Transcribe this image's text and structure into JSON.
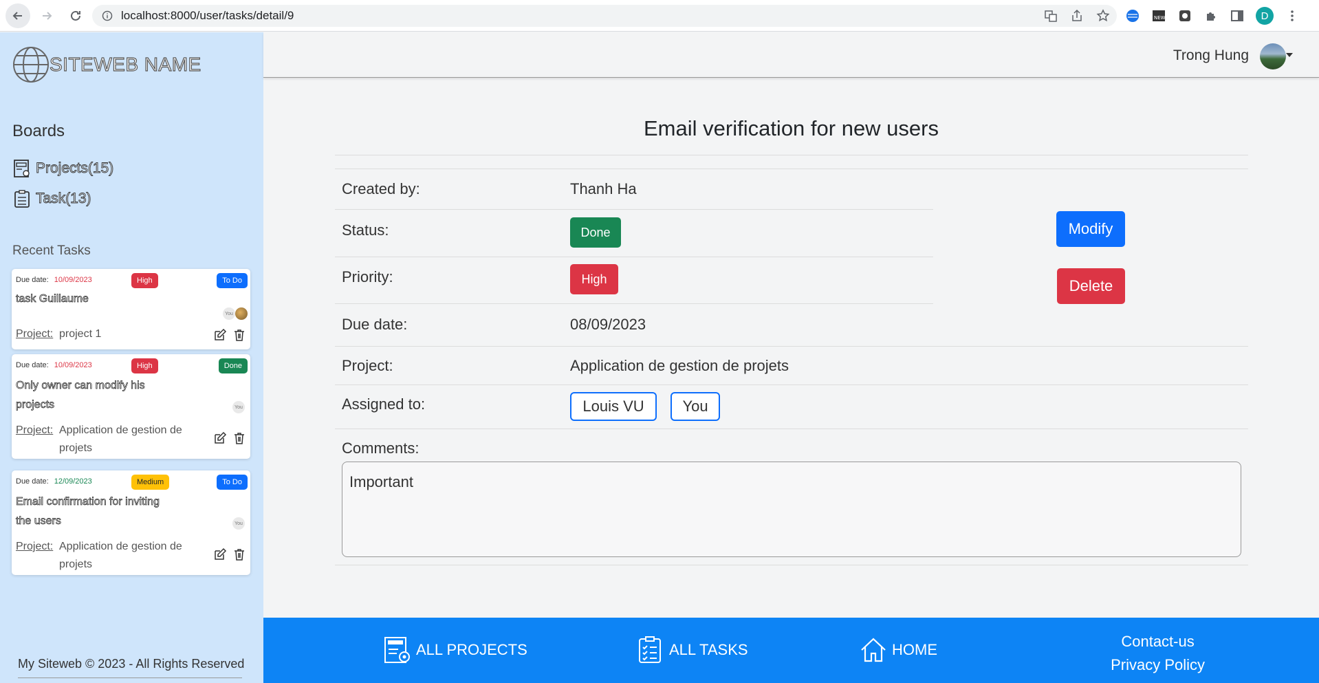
{
  "browser": {
    "url": "localhost:8000/user/tasks/detail/9",
    "profile_initial": "D"
  },
  "sidebar": {
    "logo_text": "SITEWEB NAME",
    "boards_title": "Boards",
    "projects_link": "Projects(15)",
    "tasks_link": "Task(13)",
    "recent_title": "Recent Tasks",
    "due_label": "Due date:",
    "project_label": "Project:",
    "you_label": "You",
    "recent_tasks": [
      {
        "due": "10/09/2023",
        "priority": "High",
        "status": "To Do",
        "name": "task Guillaume",
        "project": "project 1"
      },
      {
        "due": "10/09/2023",
        "priority": "High",
        "status": "Done",
        "name": "Only owner can modify his projects",
        "project": "Application de gestion de projets"
      },
      {
        "due": "12/09/2023",
        "priority": "Medium",
        "status": "To Do",
        "name": "Email confirmation for inviting the users",
        "project": "Application de gestion de projets"
      }
    ],
    "copyright": "My Siteweb © 2023 - All Rights Reserved"
  },
  "header": {
    "user_name": "Trong Hung"
  },
  "task": {
    "title": "Email verification for new users",
    "created_by_label": "Created by:",
    "created_by": "Thanh Ha",
    "status_label": "Status:",
    "status": "Done",
    "priority_label": "Priority:",
    "priority": "High",
    "due_label": "Due date:",
    "due": "08/09/2023",
    "project_label": "Project:",
    "project": "Application de gestion de projets",
    "assigned_label": "Assigned to:",
    "assignees": [
      "Louis VU",
      "You"
    ],
    "comments_label": "Comments:",
    "comments": "Important",
    "modify_label": "Modify",
    "delete_label": "Delete"
  },
  "footer": {
    "all_projects": "ALL PROJECTS",
    "all_tasks": "ALL TASKS",
    "home": "HOME",
    "contact": "Contact-us",
    "privacy": "Privacy Policy"
  },
  "colors": {
    "primary": "#0d6efd",
    "danger": "#dc3545",
    "success": "#198754",
    "warning": "#ffc107",
    "sidebar_bg": "#cfe5fb",
    "footer_bg": "#0d84f5"
  }
}
